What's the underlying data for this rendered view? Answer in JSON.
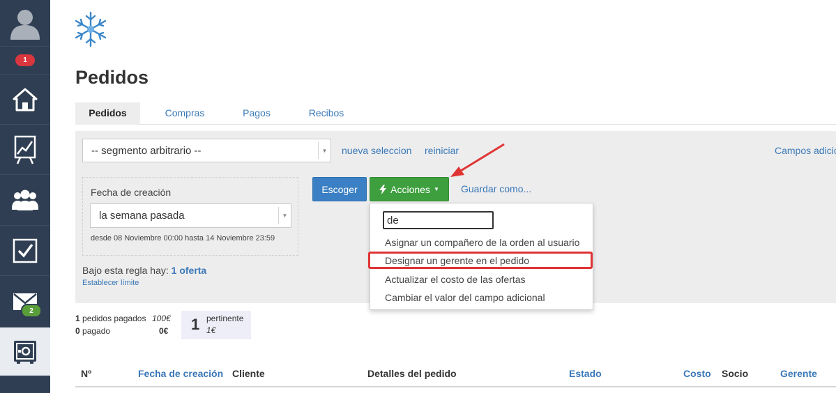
{
  "sidebar": {
    "notifications_badge": "1",
    "messages_badge": "2",
    "items": [
      {
        "name": "home",
        "icon": "home-icon"
      },
      {
        "name": "reports",
        "icon": "chart-icon"
      },
      {
        "name": "contacts",
        "icon": "users-icon"
      },
      {
        "name": "tasks",
        "icon": "checkbox-icon"
      },
      {
        "name": "messages",
        "icon": "envelope-icon"
      },
      {
        "name": "safe",
        "icon": "safe-icon"
      }
    ]
  },
  "page": {
    "title": "Pedidos",
    "tabs": [
      "Pedidos",
      "Compras",
      "Pagos",
      "Recibos"
    ]
  },
  "filters": {
    "segment_value": "-- segmento arbitrario --",
    "new_selection": "nueva seleccion",
    "reset": "reiniciar",
    "extra_fields": "Campos adicionales",
    "date_label": "Fecha de creación",
    "date_value": "la semana pasada",
    "date_range": "desde 08 Noviembre 00:00 hasta 14 Noviembre 23:59",
    "rule_prefix": "Bajo esta regla hay:",
    "rule_count": "1 oferta",
    "set_limit": "Establecer límite"
  },
  "actions": {
    "choose": "Escoger",
    "actions": "Acciones",
    "save_as": "Guardar como..."
  },
  "dropdown": {
    "search_value": "de",
    "items": [
      "Asignar un compañero de la orden al usuario",
      "Designar un gerente en el pedido",
      "Actualizar el costo de las ofertas",
      "Cambiar el valor del campo adicional"
    ],
    "highlighted_index": 1
  },
  "stats": {
    "paid_orders_count": "1",
    "paid_orders_label": "pedidos pagados",
    "paid_orders_sum": "100€",
    "paid_count": "0",
    "paid_label": "pagado",
    "paid_sum": "0€",
    "pertinent_count": "1",
    "pertinent_label": "pertinente",
    "pertinent_sum": "1€"
  },
  "table": {
    "columns": [
      "Nº",
      "Fecha de creación",
      "Cliente",
      "Detalles del pedido",
      "Estado",
      "Costo",
      "Socio",
      "Gerente"
    ]
  },
  "colors": {
    "sidebar": "#2f3e52",
    "link": "#3a78b8",
    "primary_button": "#3b80c4",
    "actions_button": "#3e9f3e",
    "highlight": "#e03434",
    "arrow": "#e03434"
  }
}
